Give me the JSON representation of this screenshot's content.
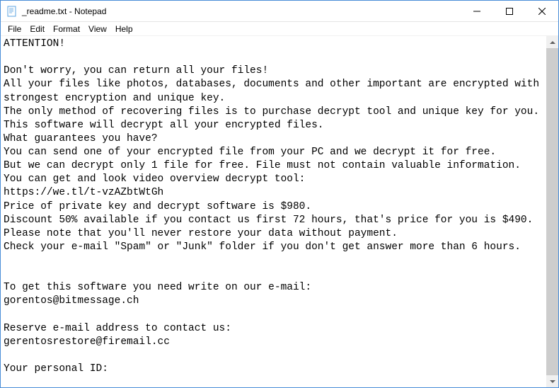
{
  "window": {
    "title": "_readme.txt - Notepad"
  },
  "menu": {
    "file": "File",
    "edit": "Edit",
    "format": "Format",
    "view": "View",
    "help": "Help"
  },
  "content": {
    "text": "ATTENTION!\n\nDon't worry, you can return all your files!\nAll your files like photos, databases, documents and other important are encrypted with strongest encryption and unique key.\nThe only method of recovering files is to purchase decrypt tool and unique key for you.\nThis software will decrypt all your encrypted files.\nWhat guarantees you have?\nYou can send one of your encrypted file from your PC and we decrypt it for free.\nBut we can decrypt only 1 file for free. File must not contain valuable information.\nYou can get and look video overview decrypt tool:\nhttps://we.tl/t-vzAZbtWtGh\nPrice of private key and decrypt software is $980.\nDiscount 50% available if you contact us first 72 hours, that's price for you is $490.\nPlease note that you'll never restore your data without payment.\nCheck your e-mail \"Spam\" or \"Junk\" folder if you don't get answer more than 6 hours.\n\n\nTo get this software you need write on our e-mail:\ngorentos@bitmessage.ch\n\nReserve e-mail address to contact us:\ngerentosrestore@firemail.cc\n\nYour personal ID:"
  }
}
